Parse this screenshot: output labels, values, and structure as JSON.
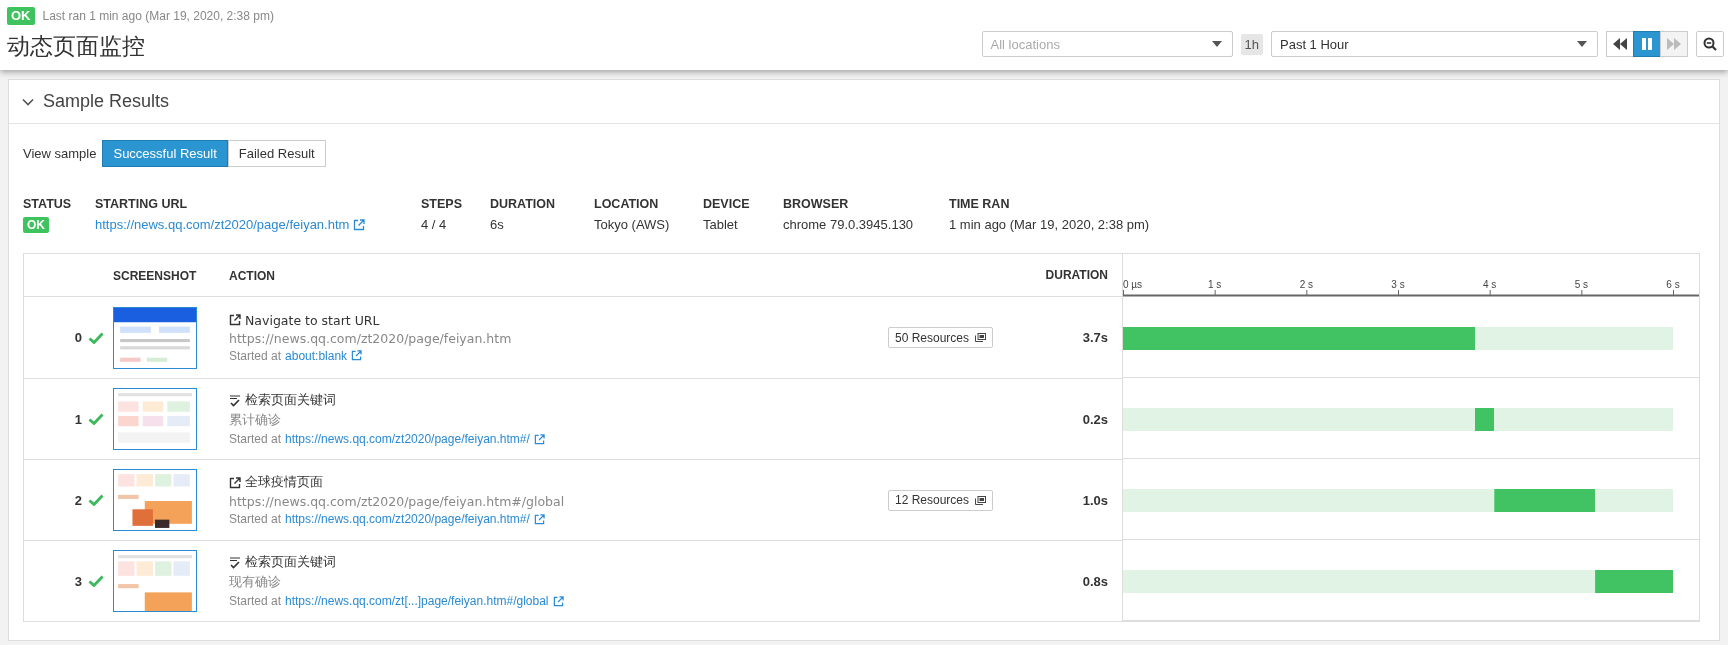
{
  "header": {
    "status": "OK",
    "last_ran": "Last ran 1 min ago (Mar 19, 2020, 2:38 pm)",
    "title": "动态页面监控",
    "location_select": {
      "placeholder": "All locations"
    },
    "range_badge": "1h",
    "range_select": {
      "value": "Past 1 Hour"
    },
    "playback": [
      {
        "kind": "back",
        "selected": false,
        "disabled": false
      },
      {
        "kind": "pause",
        "selected": true,
        "disabled": false
      },
      {
        "kind": "forward",
        "selected": false,
        "disabled": true
      }
    ]
  },
  "panel": {
    "title": "Sample Results",
    "expanded": true,
    "view_label": "View sample",
    "toggle": [
      {
        "label": "Successful Result",
        "selected": true
      },
      {
        "label": "Failed Result",
        "selected": false
      }
    ],
    "summary": [
      {
        "label": "STATUS",
        "value": "OK",
        "kind": "badge"
      },
      {
        "label": "STARTING URL",
        "value": "https://news.qq.com/zt2020/page/feiyan.htm",
        "kind": "link"
      },
      {
        "label": "STEPS",
        "value": "4 / 4",
        "kind": "text"
      },
      {
        "label": "DURATION",
        "value": "6s",
        "kind": "text"
      },
      {
        "label": "LOCATION",
        "value": "Tokyo (AWS)",
        "kind": "text"
      },
      {
        "label": "DEVICE",
        "value": "Tablet",
        "kind": "text"
      },
      {
        "label": "BROWSER",
        "value": "chrome 79.0.3945.130",
        "kind": "text"
      },
      {
        "label": "TIME RAN",
        "value": "1 min ago (Mar 19, 2020, 2:38 pm)",
        "kind": "text"
      }
    ],
    "steps": {
      "columns": [
        "SCREENSHOT",
        "ACTION",
        "DURATION"
      ],
      "rows": [
        {
          "index": "0",
          "passed": true,
          "kind": "navigate",
          "title": "Navigate to start URL",
          "detail": "https://news.qq.com/zt2020/page/feiyan.htm",
          "started_prefix": "Started at",
          "started_url": "about:blank",
          "resources": "50 Resources",
          "duration": "3.7s"
        },
        {
          "index": "1",
          "passed": true,
          "kind": "assert",
          "title": "检索页面关键词",
          "detail": "累计确诊",
          "started_prefix": "Started at",
          "started_url": "https://news.qq.com/zt2020/page/feiyan.htm#/",
          "duration": "0.2s"
        },
        {
          "index": "2",
          "passed": true,
          "kind": "navigate",
          "title": "全球疫情页面",
          "detail": "https://news.qq.com/zt2020/page/feiyan.htm#/global",
          "started_prefix": "Started at",
          "started_url": "https://news.qq.com/zt2020/page/feiyan.htm#/",
          "resources": "12 Resources",
          "duration": "1.0s"
        },
        {
          "index": "3",
          "passed": true,
          "kind": "assert",
          "title": "检索页面关键词",
          "detail": "现有确诊",
          "started_prefix": "Started at",
          "started_url": "https://news.qq.com/zt[...]page/feiyan.htm#/global",
          "duration": "0.8s"
        }
      ]
    },
    "waterfall": {
      "chart_data": {
        "type": "bar",
        "orientation": "horizontal",
        "stacked": true,
        "series": [
          {
            "color": "#e0f3e4",
            "values": [
              0,
              3.84,
              4.05,
              5.15
            ]
          },
          {
            "color": "#41c363",
            "values": [
              3.84,
              0.21,
              1.1,
              0.85
            ]
          },
          {
            "color": "#e0f3e4",
            "values": [
              2.16,
              1.95,
              0.85,
              0
            ]
          }
        ],
        "xlim": [
          0,
          6
        ],
        "xticks": [
          {
            "value": 0,
            "label": "0 µs"
          },
          {
            "value": 1,
            "label": "1 s"
          },
          {
            "value": 2,
            "label": "2 s"
          },
          {
            "value": 3,
            "label": "3 s"
          },
          {
            "value": 4,
            "label": "4 s"
          },
          {
            "value": 5,
            "label": "5 s"
          },
          {
            "value": 6,
            "label": "6 s"
          }
        ]
      }
    }
  }
}
